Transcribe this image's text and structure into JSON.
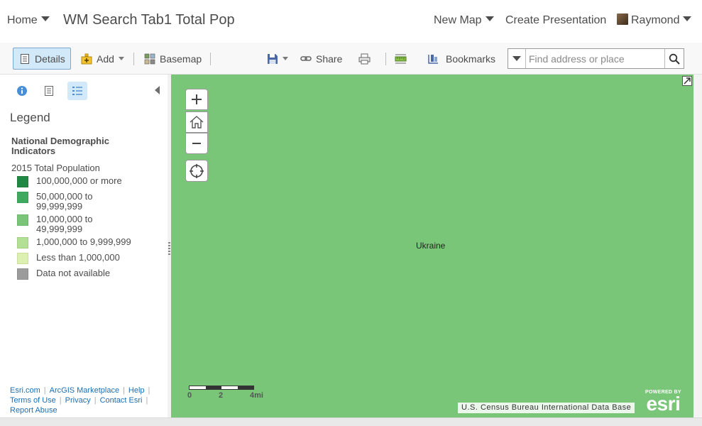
{
  "header": {
    "home_label": "Home",
    "title": "WM Search Tab1 Total Pop",
    "new_map_label": "New Map",
    "create_presentation_label": "Create Presentation",
    "user_name": "Raymond"
  },
  "toolbar": {
    "details_label": "Details",
    "add_label": "Add",
    "basemap_label": "Basemap",
    "share_label": "Share",
    "bookmarks_label": "Bookmarks",
    "search_placeholder": "Find address or place"
  },
  "sidebar": {
    "legend_title": "Legend",
    "layer_name": "National Demographic Indicators",
    "field_name": "2015 Total Population",
    "legend_items": [
      {
        "label": "100,000,000 or more",
        "color": "#1f8845"
      },
      {
        "label": "50,000,000 to 99,999,999",
        "color": "#3faa5e"
      },
      {
        "label": "10,000,000 to 49,999,999",
        "color": "#79c679"
      },
      {
        "label": "1,000,000 to 9,999,999",
        "color": "#b3e094"
      },
      {
        "label": "Less than 1,000,000",
        "color": "#dcf1b0"
      },
      {
        "label": "Data not available",
        "color": "#9c9c9c"
      }
    ],
    "footer": {
      "esri_com": "Esri.com",
      "marketplace": "ArcGIS Marketplace",
      "help": "Help",
      "terms": "Terms of Use",
      "privacy": "Privacy",
      "contact": "Contact Esri",
      "report_abuse": "Report Abuse"
    }
  },
  "map": {
    "feature_label": "Ukraine",
    "scale": {
      "start": "0",
      "mid": "2",
      "end": "4mi"
    },
    "attribution": "U.S. Census Bureau International Data Base",
    "logo_powered": "POWERED BY",
    "logo_word": "esri",
    "fill_color": "#79c679"
  }
}
